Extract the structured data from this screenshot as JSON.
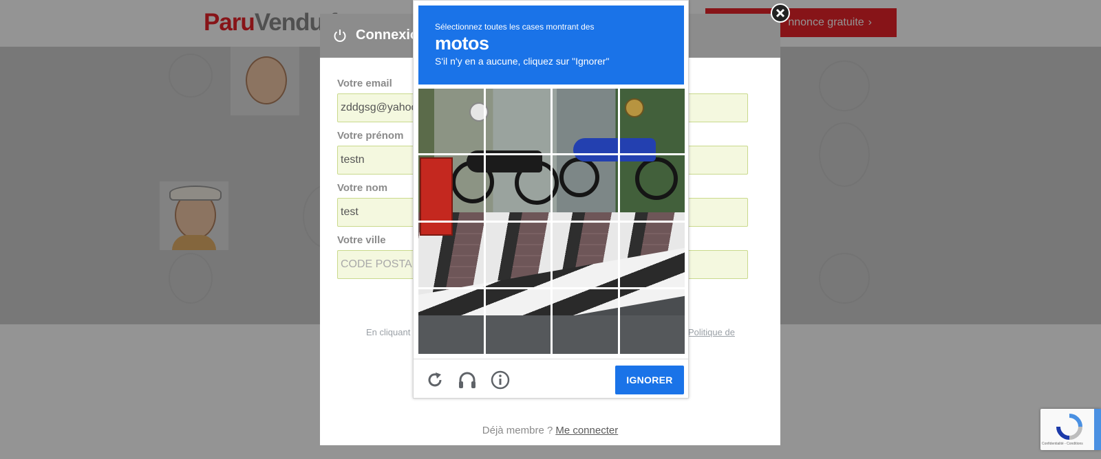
{
  "site": {
    "logo_part1": "Paru",
    "logo_part2": "Vendu.f",
    "cta_label": "nnonce gratuite",
    "cta_chevron": "›"
  },
  "modal": {
    "title": "Connexio",
    "fields": [
      {
        "label": "Votre email",
        "value": "zddgsg@yahoo"
      },
      {
        "label": "Votre prénom",
        "value": "testn"
      },
      {
        "label": "Votre nom",
        "value": "test"
      },
      {
        "label": "Votre ville",
        "placeholder": "CODE POSTAL"
      }
    ],
    "terms_left": "En cliquant",
    "terms_right": "Politique de",
    "already_member": "Déjà membre ?",
    "login_link": "Me connecter"
  },
  "captcha": {
    "instruction": "Sélectionnez toutes les cases montrant des",
    "target": "motos",
    "hint": "S'il n'y en a aucune, cliquez sur \"Ignorer\"",
    "grid_rows": 4,
    "grid_cols": 4,
    "ignore_label": "IGNORER",
    "icons": [
      "reload-icon",
      "headphones-icon",
      "info-icon"
    ],
    "accent_color": "#1a73e8"
  },
  "badge": {
    "footer_text": "Confidentialité - Conditions"
  }
}
